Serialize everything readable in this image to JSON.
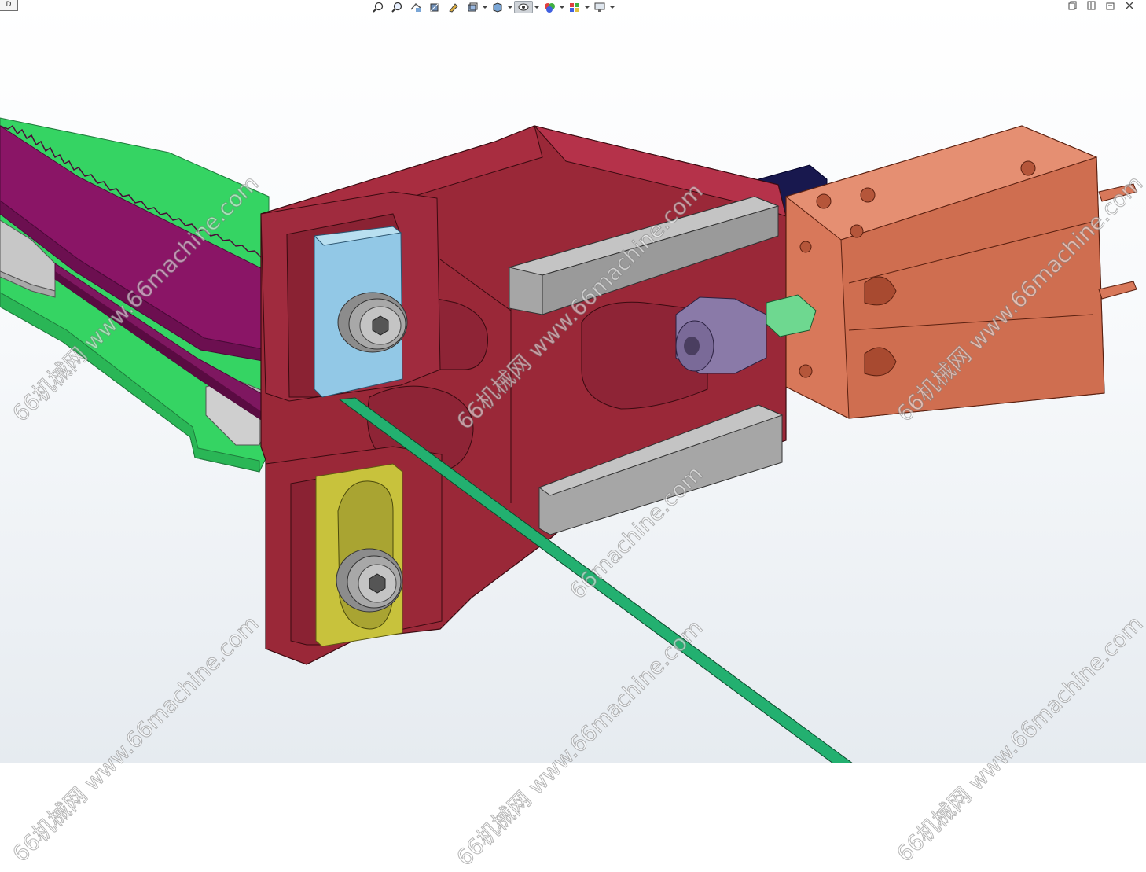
{
  "window": {
    "corner_tab_label": "D"
  },
  "toolbar": {
    "buttons": [
      {
        "icon": "zoom-to-fit-icon"
      },
      {
        "icon": "zoom-to-area-icon"
      },
      {
        "icon": "previous-view-icon"
      },
      {
        "icon": "section-view-icon"
      },
      {
        "icon": "dynamic-annotation-icon"
      },
      {
        "icon": "view-orientation-icon"
      },
      {
        "icon": "display-style-icon"
      },
      {
        "icon": "hide-show-items-icon"
      },
      {
        "icon": "edit-appearance-icon"
      },
      {
        "icon": "apply-scene-icon"
      },
      {
        "icon": "view-settings-icon"
      }
    ]
  },
  "window_controls": [
    "restore-icon",
    "maximize-icon",
    "close-icon"
  ],
  "watermark": {
    "text": "66机械网 www.66machine.com",
    "text_alt": "66machine.com"
  },
  "colors": {
    "base_plate": "#35d463",
    "rack": "#8a1566",
    "bracket": "#9a2838",
    "cylinder": "#d8785a",
    "clamp_bar": "#a6a6a6",
    "top_insert": "#92c8e6",
    "bottom_insert": "#c8c23c",
    "strip": "#23b070",
    "fitting": "#6ed890",
    "motor": "#18184e",
    "nut": "#8a7aa8"
  }
}
